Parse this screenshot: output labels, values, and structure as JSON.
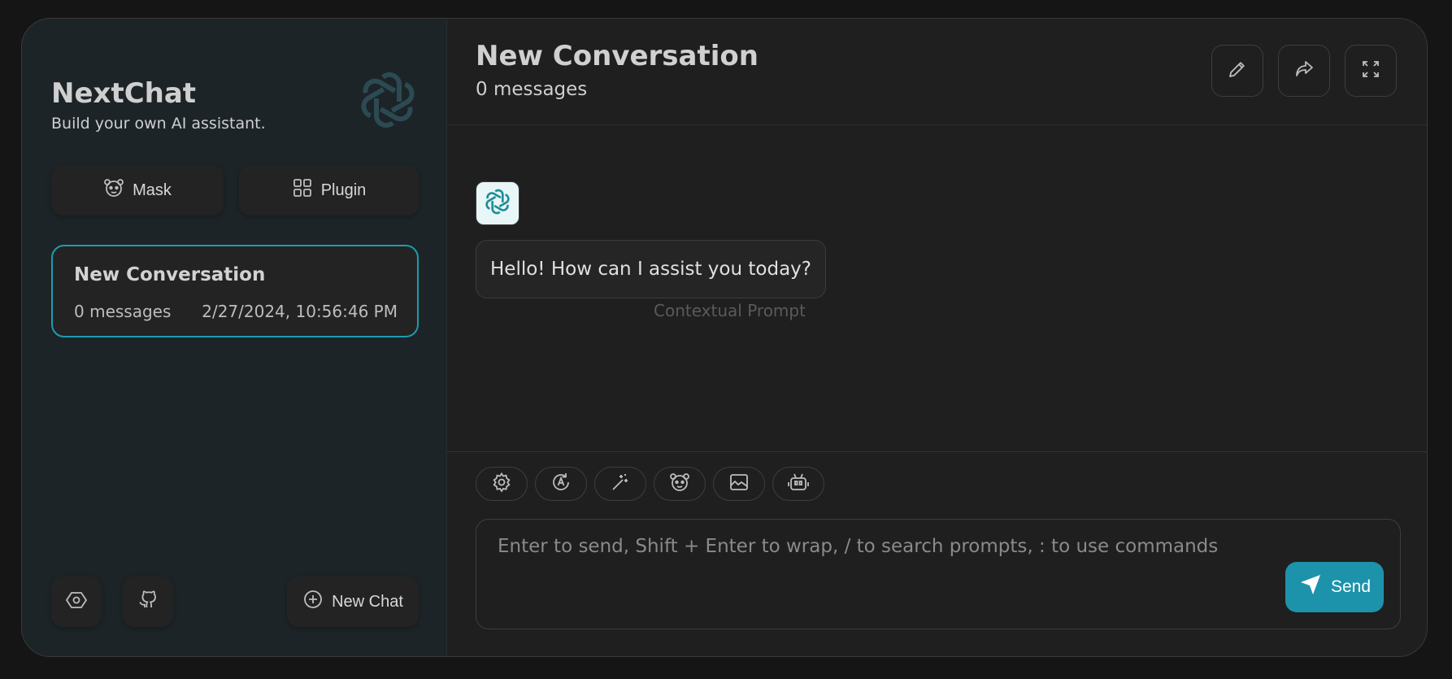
{
  "sidebar": {
    "app_title": "NextChat",
    "app_subtitle": "Build your own AI assistant.",
    "logo_icon": "openai-logo-icon",
    "mask_label": "Mask",
    "plugin_label": "Plugin",
    "conversations": [
      {
        "title": "New Conversation",
        "count": "0 messages",
        "date": "2/27/2024, 10:56:46 PM",
        "active": true
      }
    ],
    "settings_icon": "settings-icon",
    "github_icon": "github-icon",
    "new_chat_label": "New Chat"
  },
  "header": {
    "title": "New Conversation",
    "subtitle": "0 messages",
    "buttons": [
      "edit-icon",
      "share-icon",
      "fullscreen-icon"
    ]
  },
  "messages": [
    {
      "role": "assistant",
      "text": "Hello! How can I assist you today?",
      "note": "Contextual Prompt"
    }
  ],
  "toolbar": {
    "items": [
      "settings-icon",
      "auto-theme-icon",
      "magic-wand-icon",
      "mask-icon",
      "image-icon",
      "robot-icon"
    ]
  },
  "composer": {
    "placeholder": "Enter to send, Shift + Enter to wrap, / to search prompts, : to use commands",
    "value": "",
    "send_label": "Send"
  },
  "colors": {
    "accent": "#1d93ab",
    "sidebar_bg": "#1c2428",
    "main_bg": "#1f1f1f"
  }
}
